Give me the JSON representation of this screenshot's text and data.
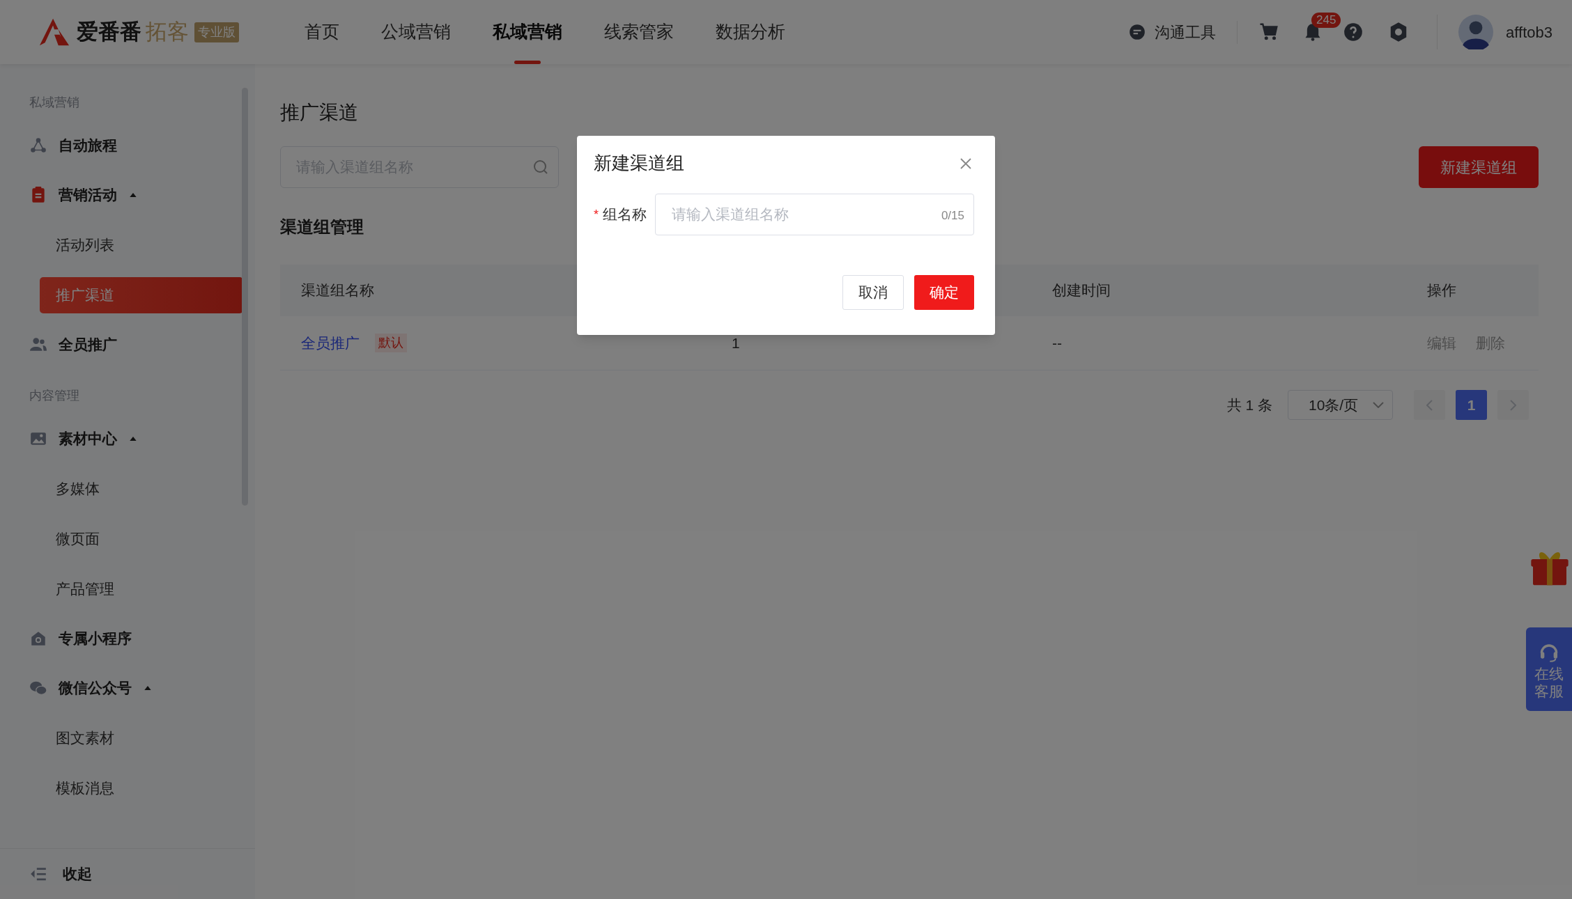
{
  "header": {
    "logo": {
      "name": "爱番番",
      "product": "拓客",
      "edition": "专业版"
    },
    "nav": [
      {
        "label": "首页",
        "selected": false
      },
      {
        "label": "公域营销",
        "selected": false
      },
      {
        "label": "私域营销",
        "selected": true
      },
      {
        "label": "线索管家",
        "selected": false
      },
      {
        "label": "数据分析",
        "selected": false
      }
    ],
    "tools_label": "沟通工具",
    "notification_count": "245",
    "username": "afftob3"
  },
  "sidebar": {
    "sections": [
      {
        "label": "私域营销",
        "items": [
          {
            "label": "自动旅程"
          },
          {
            "label": "营销活动",
            "expanded": true,
            "children": [
              {
                "label": "活动列表",
                "selected": false
              },
              {
                "label": "推广渠道",
                "selected": true
              }
            ]
          },
          {
            "label": "全员推广"
          }
        ]
      },
      {
        "label": "内容管理",
        "items": [
          {
            "label": "素材中心",
            "expanded": true,
            "children": [
              {
                "label": "多媒体",
                "selected": false
              },
              {
                "label": "微页面",
                "selected": false
              },
              {
                "label": "产品管理",
                "selected": false
              }
            ]
          },
          {
            "label": "专属小程序"
          },
          {
            "label": "微信公众号",
            "expanded": true,
            "children": [
              {
                "label": "图文素材",
                "selected": false
              },
              {
                "label": "模板消息",
                "selected": false
              }
            ]
          }
        ]
      }
    ],
    "collapse": "收起"
  },
  "page": {
    "title": "推广渠道",
    "search": {
      "placeholder": "请输入渠道组名称"
    },
    "new_button": "新建渠道组",
    "section_title": "渠道组管理",
    "table": {
      "columns": [
        "渠道组名称",
        "创建时间",
        "操作"
      ],
      "rows": [
        {
          "name": "全员推广",
          "tag": "默认",
          "column_2": "1",
          "created": "--",
          "actions": [
            "编辑",
            "删除"
          ]
        }
      ]
    },
    "pagination": {
      "total": "共 1 条",
      "page_size": "10条/页",
      "pages": [
        {
          "label": "1",
          "selected": true
        }
      ]
    }
  },
  "modal": {
    "title": "新建渠道组",
    "field": {
      "required_mark": "*",
      "label": "组名称",
      "placeholder": "请输入渠道组名称",
      "count": "0/15"
    },
    "buttons": [
      {
        "label": "取消",
        "kind": "secondary"
      },
      {
        "label": "确定",
        "kind": "primary"
      }
    ]
  },
  "floating": {
    "service_label": "在线客服"
  }
}
